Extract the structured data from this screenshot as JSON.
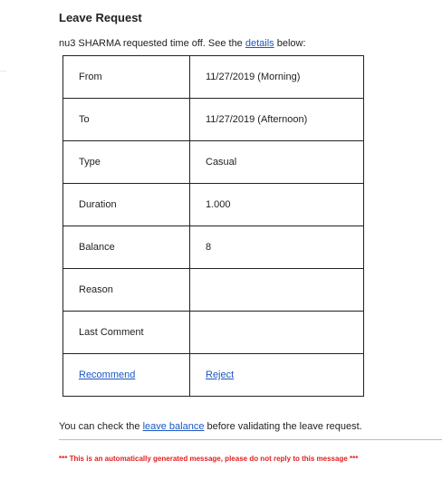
{
  "email": {
    "title": "Leave Request",
    "intro": {
      "prefix": "nu3 SHARMA requested time off. See the ",
      "link": "details",
      "suffix": " below:"
    },
    "rows": [
      {
        "label": "From",
        "value": "11/27/2019 (Morning)"
      },
      {
        "label": "To",
        "value": "11/27/2019 (Afternoon)"
      },
      {
        "label": "Type",
        "value": "Casual"
      },
      {
        "label": "Duration",
        "value": "1.000"
      },
      {
        "label": "Balance",
        "value": "8"
      },
      {
        "label": "Reason",
        "value": ""
      },
      {
        "label": "Last Comment",
        "value": ""
      }
    ],
    "actions": {
      "recommend": "Recommend",
      "reject": "Reject"
    },
    "footer": {
      "prefix": "You can check the ",
      "link": "leave balance",
      "suffix": " before validating the leave request."
    },
    "warning": "*** This is an automatically generated message, please do not reply to this message ***"
  },
  "colors": {
    "link": "#1a57c2",
    "warning": "#e02020",
    "border": "#222222"
  }
}
